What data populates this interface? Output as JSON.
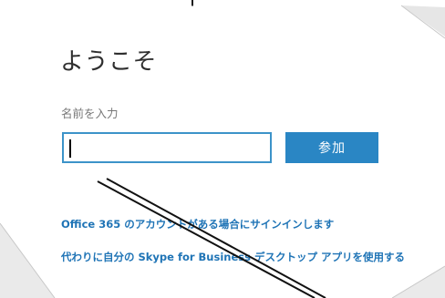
{
  "header": {
    "title": "ようこそ"
  },
  "form": {
    "name_label": "名前を入力",
    "name_value": "",
    "join_label": "参加"
  },
  "links": {
    "signin": "Office 365 のアカウントがある場合にサインインします",
    "desktop_app": "代わりに自分の Skype for Business デスクトップ アプリを使用する"
  },
  "colors": {
    "accent": "#2a86c4",
    "input_border": "#3c93c9",
    "link": "#1f74b6"
  }
}
